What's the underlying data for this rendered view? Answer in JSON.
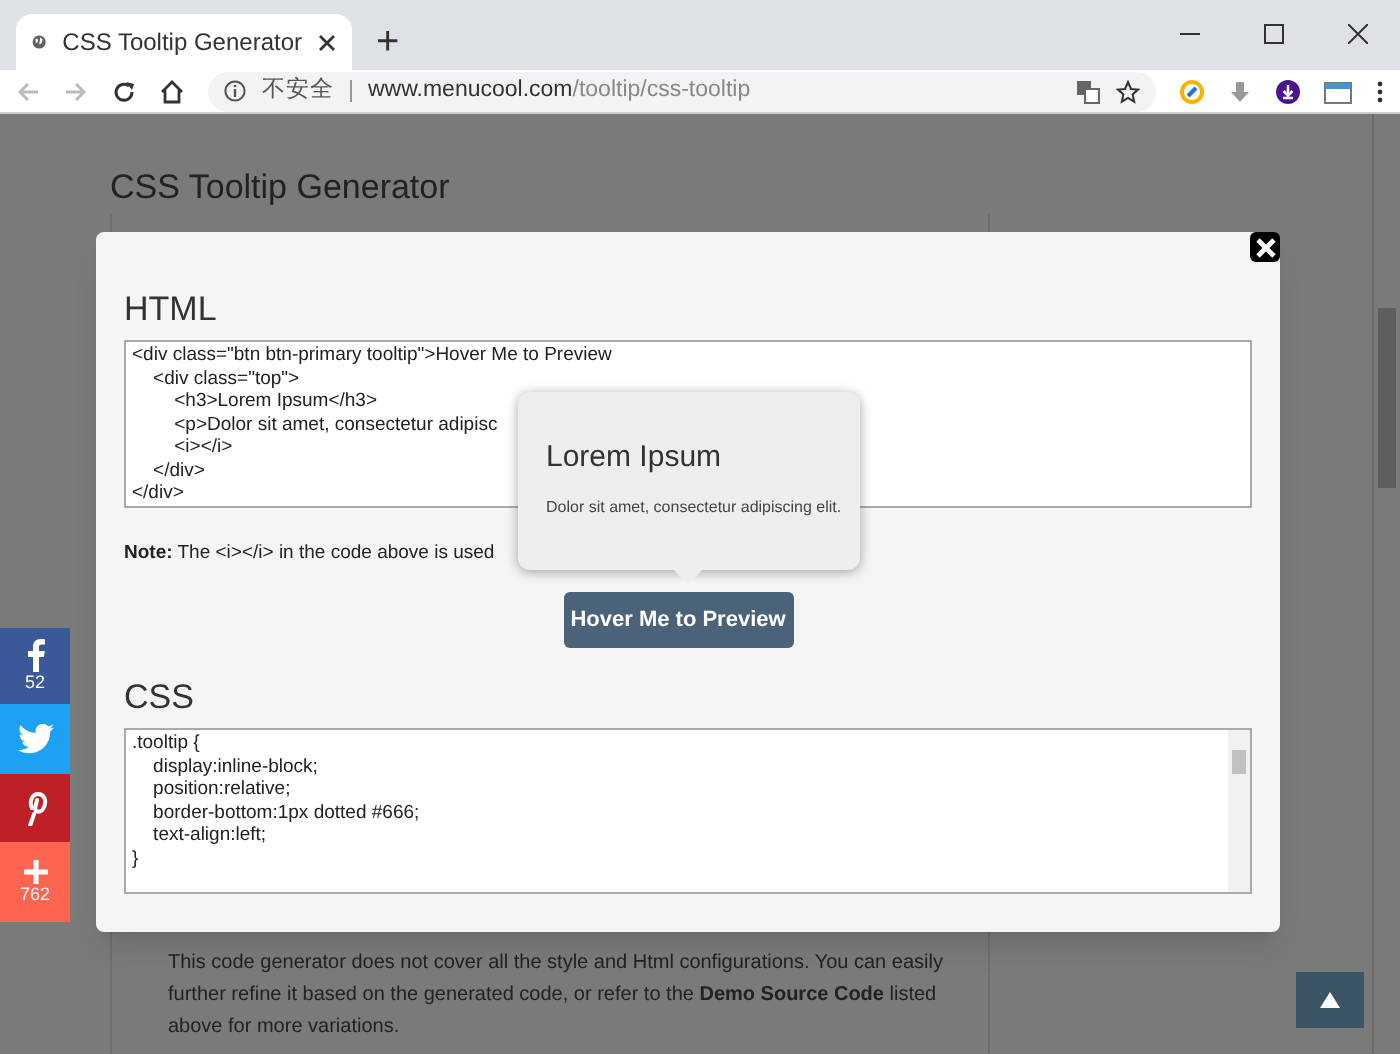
{
  "browser": {
    "tab_title": "CSS Tooltip Generator",
    "new_tab": "+",
    "security": "不安全",
    "url_host": "www.menucool.com",
    "url_path": "/tooltip/css-tooltip"
  },
  "page": {
    "title": "CSS Tooltip Generator",
    "footer": "This code generator does not cover all the style and Html configurations. You can easily further refine it based on the generated code, or refer to the **Demo Source Code** listed above for more variations."
  },
  "modal": {
    "html": {
      "heading": "HTML",
      "lines": [
        "<div class=\"btn btn-primary tooltip\">Hover Me to Preview",
        "    <div class=\"top\">",
        "        <h3>Lorem Ipsum</h3>",
        "        <p>Dolor sit amet, consectetur adipisc",
        "        <i></i>",
        "    </div>",
        "</div>"
      ]
    },
    "note": "**Note:** The <i></i> in the code above is used",
    "tooltip": {
      "title": "Lorem Ipsum",
      "text": "Dolor sit amet, consectetur adipiscing elit."
    },
    "preview_button": "Hover Me to Preview",
    "css": {
      "heading": "CSS",
      "lines": [
        ".tooltip {",
        "    display:inline-block;",
        "    position:relative;",
        "    border-bottom:1px dotted #666;",
        "    text-align:left;",
        "}"
      ]
    }
  },
  "share": [
    {
      "kind": "facebook",
      "count": "52"
    },
    {
      "kind": "twitter"
    },
    {
      "kind": "pinterest"
    },
    {
      "kind": "plus",
      "count": "762"
    }
  ]
}
